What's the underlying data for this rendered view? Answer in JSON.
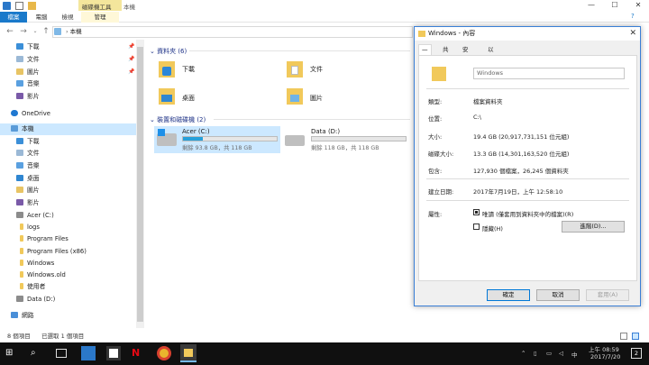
{
  "window": {
    "ctx_tab": "磁碟機工具",
    "title": "本機",
    "min": "—",
    "max": "☐",
    "close": "✕"
  },
  "ribbon": {
    "tabs": [
      "檔案",
      "電腦",
      "檢視",
      "管理"
    ]
  },
  "address": {
    "path": "本機"
  },
  "sidebar": {
    "items": [
      {
        "label": "下載",
        "icon": "download-folder-icon",
        "pinned": true
      },
      {
        "label": "文件",
        "icon": "documents-folder-icon",
        "pinned": true
      },
      {
        "label": "圖片",
        "icon": "pictures-folder-icon",
        "pinned": true
      },
      {
        "label": "音樂",
        "icon": "music-folder-icon"
      },
      {
        "label": "影片",
        "icon": "videos-folder-icon"
      },
      {
        "label": "OneDrive",
        "icon": "onedrive-icon"
      },
      {
        "label": "本機",
        "icon": "this-pc-icon",
        "selected": true
      },
      {
        "label": "下載",
        "icon": "download-folder-icon"
      },
      {
        "label": "文件",
        "icon": "documents-folder-icon"
      },
      {
        "label": "音樂",
        "icon": "music-folder-icon"
      },
      {
        "label": "桌面",
        "icon": "desktop-folder-icon"
      },
      {
        "label": "圖片",
        "icon": "pictures-folder-icon"
      },
      {
        "label": "影片",
        "icon": "videos-folder-icon"
      },
      {
        "label": "Acer (C:)",
        "icon": "drive-icon"
      },
      {
        "label": "logs",
        "icon": "folder-icon"
      },
      {
        "label": "Program Files",
        "icon": "folder-icon"
      },
      {
        "label": "Program Files (x86)",
        "icon": "folder-icon"
      },
      {
        "label": "Windows",
        "icon": "folder-icon"
      },
      {
        "label": "Windows.old",
        "icon": "folder-icon"
      },
      {
        "label": "使用者",
        "icon": "folder-icon"
      },
      {
        "label": "Data (D:)",
        "icon": "drive-icon"
      },
      {
        "label": "網路",
        "icon": "network-icon"
      }
    ]
  },
  "content": {
    "folders_header": "資料夾 (6)",
    "folders": [
      "下載",
      "文件",
      "桌面",
      "圖片"
    ],
    "drives_header": "裝置和磁碟機 (2)",
    "drives": [
      {
        "name": "Acer (C:)",
        "sub": "剩餘 93.8 GB，共 118 GB",
        "used": 0.21
      },
      {
        "name": "Data (D:)",
        "sub": "剩餘 118 GB，共 118 GB",
        "used": 0.0
      }
    ]
  },
  "dialog": {
    "title": "Windows - 內容",
    "tabs": [
      "一般",
      "共用",
      "安全性",
      "以前的版本"
    ],
    "name": "Windows",
    "type_label": "類型:",
    "type_value": "檔案資料夾",
    "location_label": "位置:",
    "location_value": "C:\\",
    "size_label": "大小:",
    "size_value": "19.4 GB (20,917,731,151 位元組)",
    "disk_label": "磁碟大小:",
    "disk_value": "13.3 GB (14,301,163,520 位元組)",
    "contains_label": "包含:",
    "contains_value": "127,930 個檔案，26,245 個資料夾",
    "created_label": "建立日期:",
    "created_value": "2017年7月19日，上午 12:58:10",
    "attr_label": "屬性:",
    "readonly_label": "唯讀 (僅套用到資料夾中的檔案)(R)",
    "hidden_label": "隱藏(H)",
    "advanced_btn": "進階(D)...",
    "ok_btn": "確定",
    "cancel_btn": "取消",
    "apply_btn": "套用(A)"
  },
  "status": {
    "count": "8 個項目",
    "selected": "已選取 1 個項目"
  },
  "taskbar": {
    "time": "上午 08:59",
    "date": "2017/7/20",
    "lang": "中",
    "notif": "2"
  }
}
